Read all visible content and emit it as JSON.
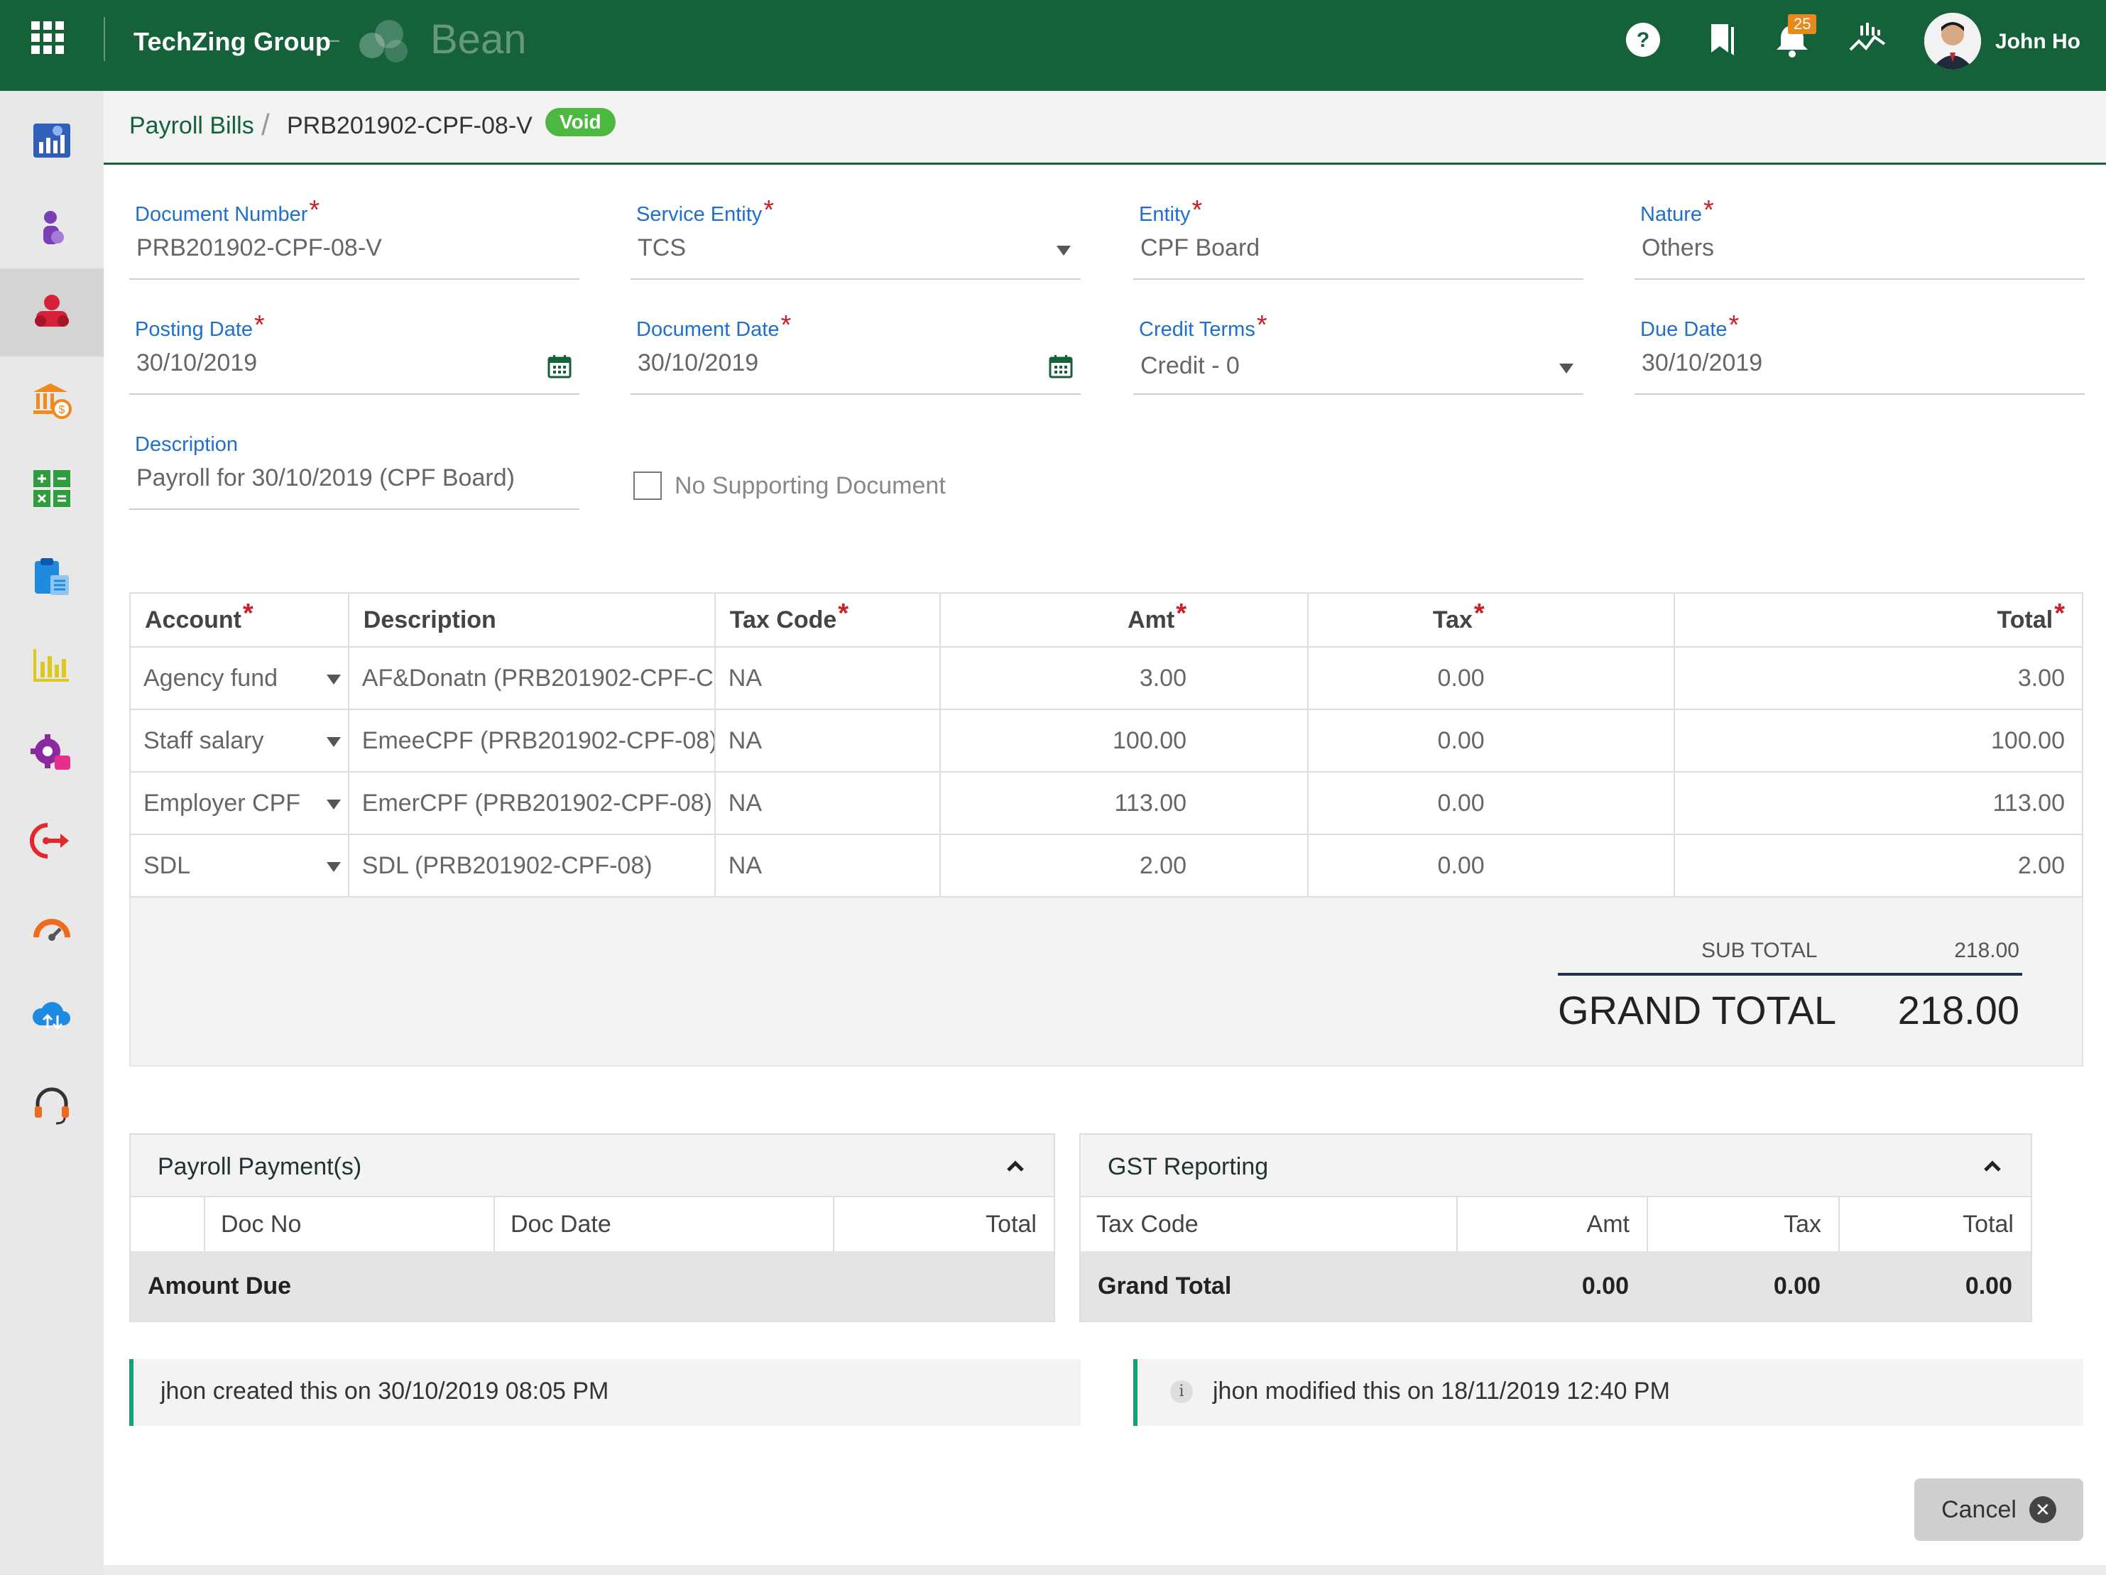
{
  "header": {
    "company": "TechZing Group",
    "separator": "–",
    "product": "Bean",
    "notification_count": "25",
    "user_name": "John Ho"
  },
  "sidebar": {
    "items": [
      {
        "icon": "dashboard-chart-icon",
        "color": "#2f5fb8"
      },
      {
        "icon": "person-icon",
        "color": "#7b3fb5"
      },
      {
        "icon": "people-group-icon",
        "color": "#d6213a",
        "active": true
      },
      {
        "icon": "bank-dollar-icon",
        "color": "#f08a1c"
      },
      {
        "icon": "calculator-icon",
        "color": "#2f9d3d"
      },
      {
        "icon": "clipboard-icon",
        "color": "#1f8be0"
      },
      {
        "icon": "bar-chart-icon",
        "color": "#e0c81a"
      },
      {
        "icon": "settings-gear-icon",
        "color": "#8a2a9e"
      },
      {
        "icon": "export-arrow-icon",
        "color": "#e5262f"
      },
      {
        "icon": "gauge-icon",
        "color": "#ef6a1f"
      },
      {
        "icon": "cloud-sync-icon",
        "color": "#1f8be0"
      },
      {
        "icon": "headset-icon",
        "color": "#ef6a1f"
      }
    ]
  },
  "breadcrumb": {
    "parent": "Payroll Bills",
    "separator": "/",
    "current": "PRB201902-CPF-08-V",
    "status": "Void"
  },
  "form": {
    "document_number": {
      "label": "Document Number",
      "value": "PRB201902-CPF-08-V"
    },
    "service_entity": {
      "label": "Service Entity",
      "value": "TCS"
    },
    "entity": {
      "label": "Entity",
      "value": "CPF Board"
    },
    "nature": {
      "label": "Nature",
      "value": "Others"
    },
    "posting_date": {
      "label": "Posting Date",
      "value": "30/10/2019"
    },
    "document_date": {
      "label": "Document Date",
      "value": "30/10/2019"
    },
    "credit_terms": {
      "label": "Credit Terms",
      "value": "Credit - 0"
    },
    "due_date": {
      "label": "Due Date",
      "value": "30/10/2019"
    },
    "description": {
      "label": "Description",
      "value": "Payroll for 30/10/2019 (CPF Board)"
    },
    "no_supporting_document": {
      "label": "No Supporting Document",
      "checked": false
    },
    "required_mark": "*"
  },
  "line_items": {
    "headers": {
      "account": "Account",
      "description": "Description",
      "tax_code": "Tax Code",
      "amt": "Amt",
      "tax": "Tax",
      "total": "Total"
    },
    "rows": [
      {
        "account": "Agency fund",
        "description": "AF&Donatn (PRB201902-CPF-C",
        "tax_code": "NA",
        "amt": "3.00",
        "tax": "0.00",
        "total": "3.00"
      },
      {
        "account": "Staff salary",
        "description": "EmeeCPF (PRB201902-CPF-08)",
        "tax_code": "NA",
        "amt": "100.00",
        "tax": "0.00",
        "total": "100.00"
      },
      {
        "account": "Employer CPF",
        "description": "EmerCPF (PRB201902-CPF-08)",
        "tax_code": "NA",
        "amt": "113.00",
        "tax": "0.00",
        "total": "113.00"
      },
      {
        "account": "SDL",
        "description": "SDL (PRB201902-CPF-08)",
        "tax_code": "NA",
        "amt": "2.00",
        "tax": "0.00",
        "total": "2.00"
      }
    ]
  },
  "totals": {
    "sub_total_label": "SUB TOTAL",
    "sub_total_value": "218.00",
    "grand_total_label": "GRAND TOTAL",
    "grand_total_value": "218.00"
  },
  "payroll_payments": {
    "title": "Payroll Payment(s)",
    "headers": {
      "doc_no": "Doc No",
      "doc_date": "Doc Date",
      "total": "Total"
    },
    "footer_label": "Amount Due"
  },
  "gst_reporting": {
    "title": "GST Reporting",
    "headers": {
      "tax_code": "Tax Code",
      "amt": "Amt",
      "tax": "Tax",
      "total": "Total"
    },
    "footer": {
      "label": "Grand Total",
      "amt": "0.00",
      "tax": "0.00",
      "total": "0.00"
    }
  },
  "audit": {
    "created": "jhon created this on 30/10/2019 08:05 PM",
    "modified": "jhon modified this on 18/11/2019 12:40 PM",
    "info_glyph": "i"
  },
  "actions": {
    "cancel_label": "Cancel",
    "cancel_glyph": "✕"
  }
}
